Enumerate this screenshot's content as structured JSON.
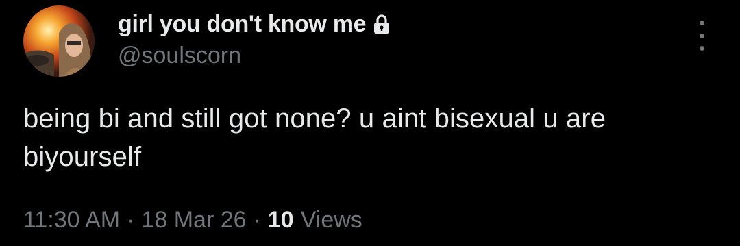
{
  "author": {
    "display_name": "girl you don't know me",
    "handle": "@soulscorn",
    "protected_icon": "lock-icon",
    "avatar": "avatar-photo"
  },
  "more_icon": "more-vertical-icon",
  "tweet": {
    "text": "being bi and still got none? u aint bisexual u are biyourself",
    "time": "11:30 AM",
    "date": "18 Mar 26",
    "separator": "·",
    "views_count": "10",
    "views_label": "Views"
  },
  "colors": {
    "background": "#000000",
    "primary_text": "#e7e9ea",
    "secondary_text": "#71767b"
  }
}
